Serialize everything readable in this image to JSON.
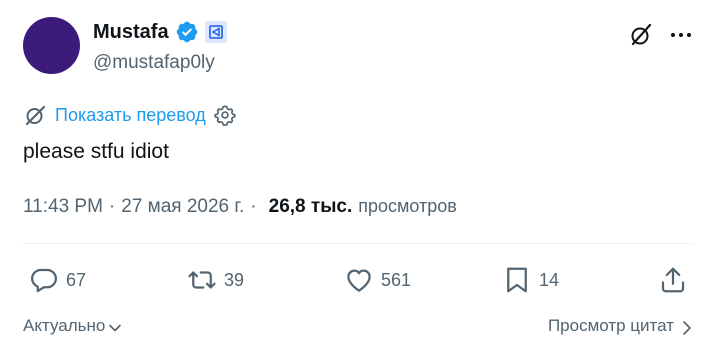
{
  "author": {
    "display_name": "Mustafa",
    "handle": "@mustafap0ly",
    "avatar_color": "#3d1b7a",
    "verified_color": "#1d9bf0"
  },
  "translate": {
    "label": "Показать перевод"
  },
  "tweet": {
    "text": "please stfu idiot"
  },
  "meta": {
    "time": "11:43 PM",
    "separator": "·",
    "date": "27 мая 2026 г.",
    "separator2": "·",
    "views_count": "26,8 тыс.",
    "views_label": "просмотров"
  },
  "actions": {
    "replies": "67",
    "reposts": "39",
    "likes": "561",
    "bookmarks": "14"
  },
  "footer": {
    "sort_label": "Актуально",
    "quotes_label": "Просмотр цитат"
  },
  "colors": {
    "accent": "#1d9bf0",
    "text_primary": "#0f1419",
    "text_secondary": "#536471"
  }
}
